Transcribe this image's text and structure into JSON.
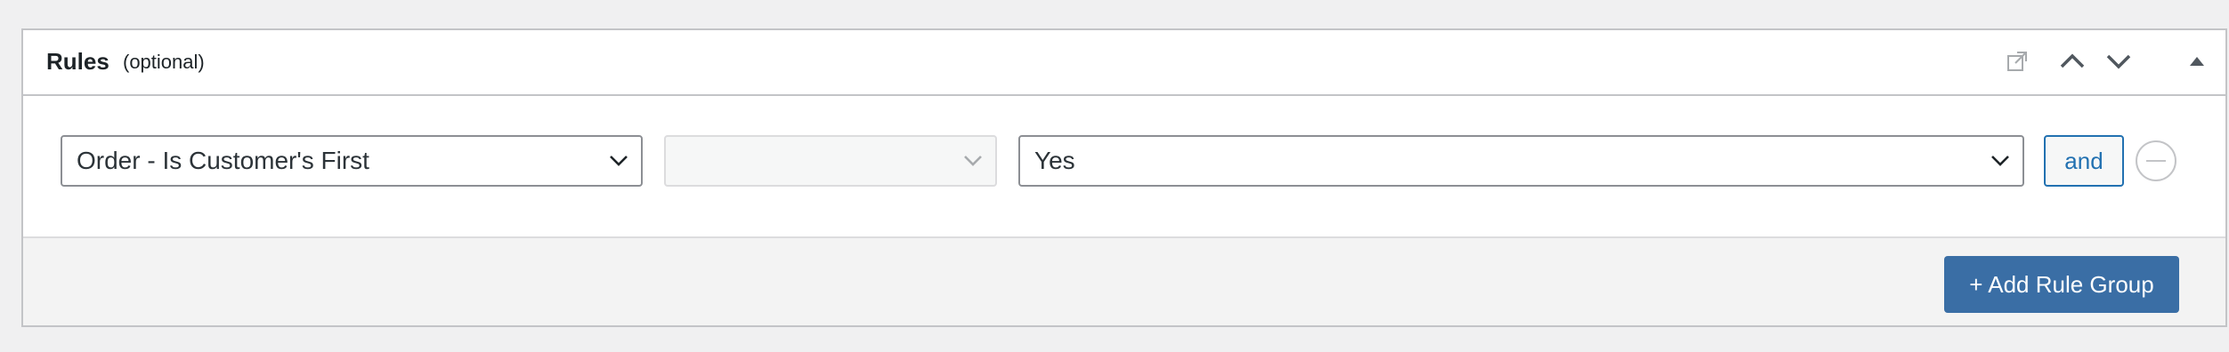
{
  "panel": {
    "title": "Rules",
    "subtitle": "(optional)",
    "header_icons": [
      "external-link-icon",
      "chevron-up-icon",
      "chevron-down-icon",
      "collapse-triangle-icon"
    ]
  },
  "rule": {
    "field_value": "Order - Is Customer's First",
    "operator_value": "",
    "value_value": "Yes",
    "and_label": "and",
    "remove_icon": "minus-circle-icon"
  },
  "footer": {
    "add_rule_group_label": "+ Add Rule Group"
  },
  "colors": {
    "accent": "#2271b1",
    "button_bg": "#3a6ea5",
    "border": "#c3c4c7"
  }
}
